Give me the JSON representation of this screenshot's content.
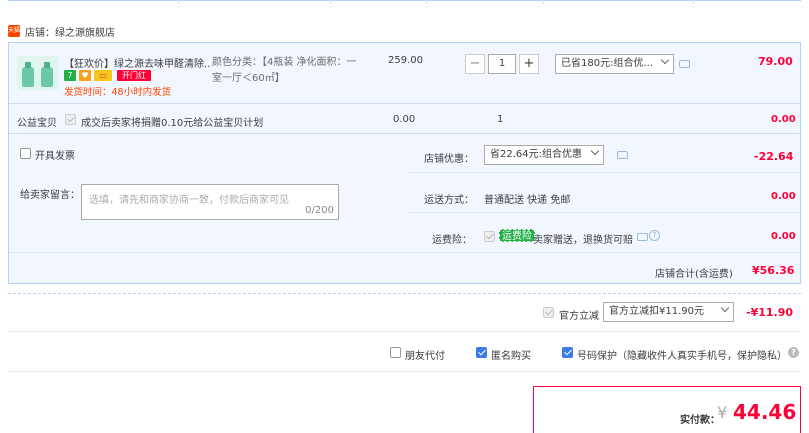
{
  "shop": {
    "logo_text": "天猫",
    "name": "店铺：绿之源旗舰店"
  },
  "product": {
    "title": "【狂欢价】绿之源去味甲醛清除...",
    "badges": [
      "7",
      "♥",
      "▭",
      "开门红"
    ],
    "shipping": "发货时间：48小时内发货",
    "sku": "颜色分类：【4瓶装 净化面积：一室一厅＜60㎡】",
    "price": "259.00",
    "quantity": "1",
    "discount_select": "已省180元:组合优...",
    "subtotal": "79.00"
  },
  "charity": {
    "label": "公益宝贝",
    "desc": "成交后卖家将捐赠0.10元给公益宝贝计划",
    "price": "0.00",
    "quantity": "1",
    "subtotal": "0.00"
  },
  "invoice": {
    "label": "开具发票"
  },
  "shop_discount": {
    "label": "店铺优惠：",
    "select": "省22.64元:组合优惠",
    "value": "-22.64"
  },
  "message": {
    "label": "给卖家留言：",
    "placeholder": "选填，请先和商家协商一致，付款后商家可见",
    "counter": "0/200"
  },
  "delivery": {
    "label": "运送方式：",
    "method": "普通配送 快递 免邮",
    "value": "0.00"
  },
  "insurance": {
    "label": "运费险：",
    "tag": "运费险",
    "desc": "卖家赠送，退换货可赔",
    "value": "0.00"
  },
  "shop_total": {
    "label": "店铺合计(含运费)",
    "value": "¥56.36"
  },
  "official": {
    "label": "官方立减",
    "select": "官方立减扣¥11.90元",
    "value": "-¥11.90"
  },
  "options": {
    "friend_pay": "朋友代付",
    "anonymous": "匿名购买",
    "privacy": "号码保护（隐藏收件人真实手机号，保护隐私）",
    "help_icon": "?"
  },
  "payment": {
    "label": "实付款：",
    "currency": "¥",
    "amount": "44.46"
  },
  "colors": {
    "accent": "#ff0036",
    "blue": "#3b7be6",
    "panel": "#f2f7ff"
  }
}
